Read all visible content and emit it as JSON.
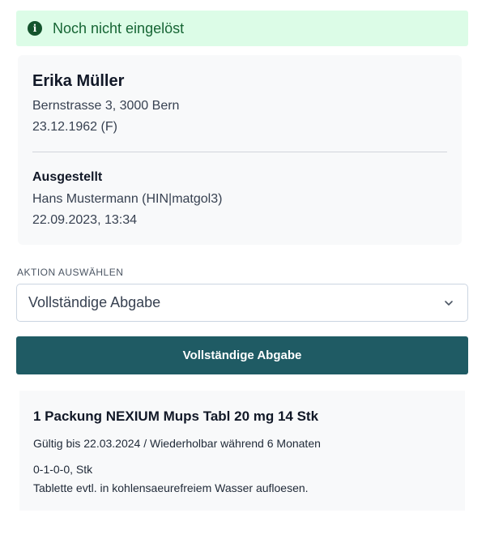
{
  "status": {
    "icon": "info-icon",
    "text": "Noch nicht eingelöst",
    "background": "#dcfce7",
    "color": "#166534"
  },
  "patient": {
    "name": "Erika Müller",
    "address": "Bernstrasse 3, 3000 Bern",
    "birth_info": "23.12.1962 (F)"
  },
  "issued": {
    "heading": "Ausgestellt",
    "by": "Hans Mustermann (HIN|matgol3)",
    "date": "22.09.2023, 13:34"
  },
  "action": {
    "label": "AKTION AUSWÄHLEN",
    "selected": "Vollständige Abgabe",
    "button_label": "Vollständige Abgabe",
    "button_color": "#1f5b64"
  },
  "medication": {
    "title": "1 Packung NEXIUM Mups Tabl 20 mg 14 Stk",
    "validity": "Gültig bis 22.03.2024 / Wiederholbar während 6 Monaten",
    "dosage": "0-1-0-0, Stk",
    "note": "Tablette evtl. in kohlensaeurefreiem Wasser aufloesen."
  }
}
